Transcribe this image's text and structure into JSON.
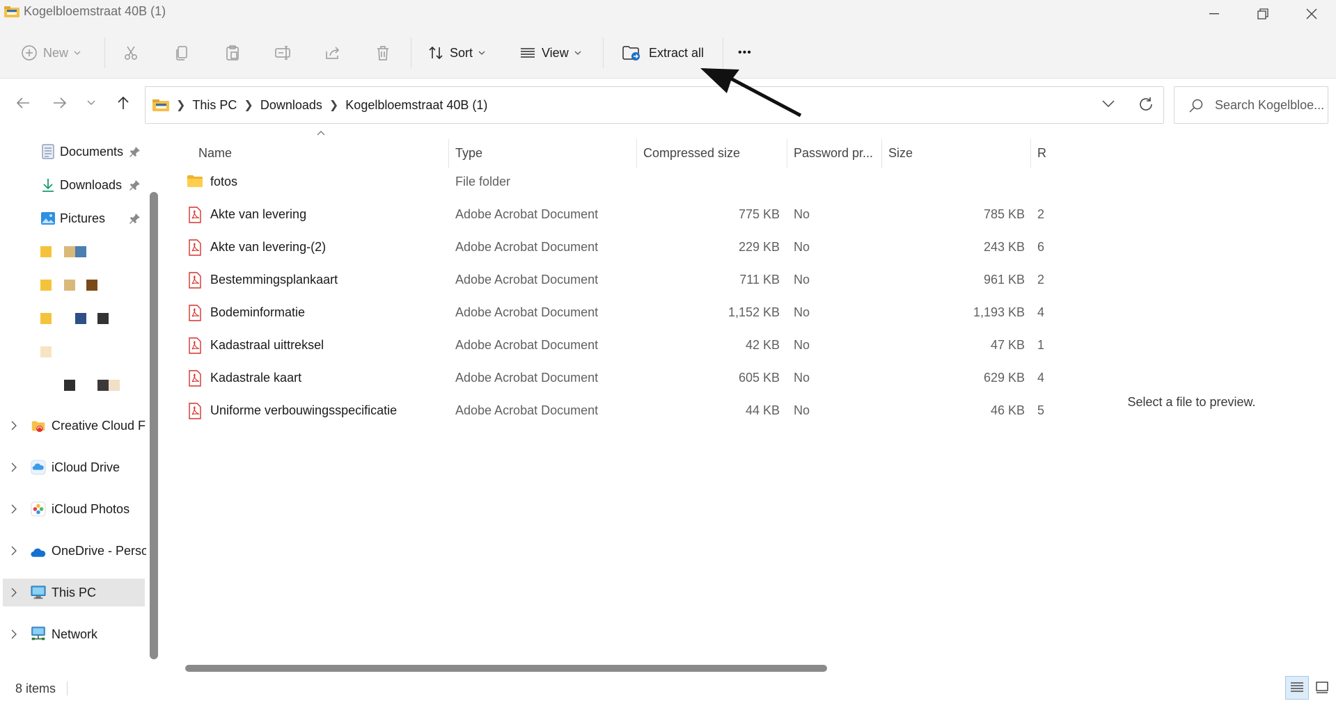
{
  "window": {
    "title": "Kogelbloemstraat 40B (1)"
  },
  "toolbar": {
    "new_label": "New",
    "sort_label": "Sort",
    "view_label": "View",
    "extract_label": "Extract all",
    "more_label": "•••"
  },
  "address": {
    "crumbs": [
      "This PC",
      "Downloads",
      "Kogelbloemstraat 40B (1)"
    ]
  },
  "search": {
    "placeholder": "Search Kogelbloe..."
  },
  "sidebar": {
    "quick_access": [
      {
        "label": "Documents",
        "icon": "documents-icon",
        "pinned": true
      },
      {
        "label": "Downloads",
        "icon": "downloads-icon",
        "pinned": true
      },
      {
        "label": "Pictures",
        "icon": "pictures-icon",
        "pinned": true
      }
    ],
    "blurred_rows": [
      {
        "colors": [
          "#f5c33b",
          "#d9b97a",
          "#4a7fb0"
        ]
      },
      {
        "colors": [
          "#f5c33b",
          "#d9b97a",
          "#7a4b1a"
        ]
      },
      {
        "colors": [
          "#f5c33b",
          "#2f4f87",
          "#333333"
        ]
      },
      {
        "colors": [
          "#f7e4c3"
        ]
      },
      {
        "colors": [
          "#2f2f2f",
          "#3d3838",
          "#f1dfc6"
        ]
      }
    ],
    "locations": [
      {
        "label": "Creative Cloud Fi",
        "icon": "creative-cloud-icon"
      },
      {
        "label": "iCloud Drive",
        "icon": "icloud-drive-icon"
      },
      {
        "label": "iCloud Photos",
        "icon": "icloud-photos-icon"
      },
      {
        "label": "OneDrive - Perso",
        "icon": "onedrive-icon"
      },
      {
        "label": "This PC",
        "icon": "this-pc-icon",
        "selected": true
      },
      {
        "label": "Network",
        "icon": "network-icon"
      }
    ]
  },
  "columns": {
    "name": "Name",
    "type": "Type",
    "compressed": "Compressed size",
    "password": "Password pr...",
    "size": "Size",
    "ratio": "Ra"
  },
  "files": [
    {
      "name": "fotos",
      "kind": "folder",
      "type": "File folder",
      "compressed": "",
      "password": "",
      "size": "",
      "ratio": ""
    },
    {
      "name": "Akte van levering",
      "kind": "pdf",
      "type": "Adobe Acrobat Document",
      "compressed": "775 KB",
      "password": "No",
      "size": "785 KB",
      "ratio": "2"
    },
    {
      "name": "Akte van levering-(2)",
      "kind": "pdf",
      "type": "Adobe Acrobat Document",
      "compressed": "229 KB",
      "password": "No",
      "size": "243 KB",
      "ratio": "6"
    },
    {
      "name": "Bestemmingsplankaart",
      "kind": "pdf",
      "type": "Adobe Acrobat Document",
      "compressed": "711 KB",
      "password": "No",
      "size": "961 KB",
      "ratio": "2"
    },
    {
      "name": "Bodeminformatie",
      "kind": "pdf",
      "type": "Adobe Acrobat Document",
      "compressed": "1,152 KB",
      "password": "No",
      "size": "1,193 KB",
      "ratio": "4"
    },
    {
      "name": "Kadastraal uittreksel",
      "kind": "pdf",
      "type": "Adobe Acrobat Document",
      "compressed": "42 KB",
      "password": "No",
      "size": "47 KB",
      "ratio": "1"
    },
    {
      "name": "Kadastrale kaart",
      "kind": "pdf",
      "type": "Adobe Acrobat Document",
      "compressed": "605 KB",
      "password": "No",
      "size": "629 KB",
      "ratio": "4"
    },
    {
      "name": "Uniforme verbouwingsspecificatie",
      "kind": "pdf",
      "type": "Adobe Acrobat Document",
      "compressed": "44 KB",
      "password": "No",
      "size": "46 KB",
      "ratio": "5"
    }
  ],
  "preview": {
    "message": "Select a file to preview."
  },
  "status": {
    "item_count": "8 items"
  }
}
